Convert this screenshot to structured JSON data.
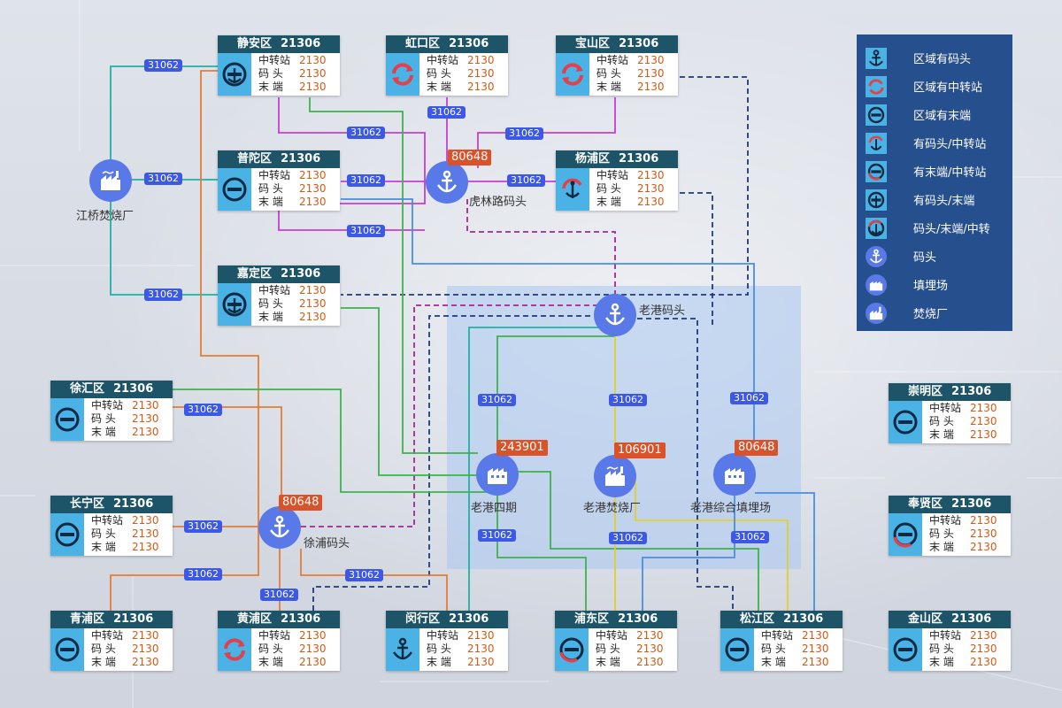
{
  "colors": {
    "card_header": "#1d5468",
    "icon_bg": "#4bb2e5",
    "node": "#5979e8",
    "pill": "#3b58e6",
    "badge": "#d9522a",
    "legend_bg": "#264f8e",
    "value": "#d35a14"
  },
  "field_labels": {
    "transfer": "中转站",
    "dock": "码 头",
    "terminal": "末 端"
  },
  "districts": [
    {
      "name": "静安区",
      "code": "21306",
      "icon": "dock-terminal-icon",
      "transfer": "2130",
      "dock": "2130",
      "terminal": "2130"
    },
    {
      "name": "虹口区",
      "code": "21306",
      "icon": "transfer-icon",
      "transfer": "2130",
      "dock": "2130",
      "terminal": "2130"
    },
    {
      "name": "宝山区",
      "code": "21306",
      "icon": "transfer-icon",
      "transfer": "2130",
      "dock": "2130",
      "terminal": "2130"
    },
    {
      "name": "普陀区",
      "code": "21306",
      "icon": "terminal-icon",
      "transfer": "2130",
      "dock": "2130",
      "terminal": "2130"
    },
    {
      "name": "杨浦区",
      "code": "21306",
      "icon": "dock-transfer-icon",
      "transfer": "2130",
      "dock": "2130",
      "terminal": "2130"
    },
    {
      "name": "嘉定区",
      "code": "21306",
      "icon": "dock-terminal-icon",
      "transfer": "2130",
      "dock": "2130",
      "terminal": "2130"
    },
    {
      "name": "徐汇区",
      "code": "21306",
      "icon": "terminal-icon",
      "transfer": "2130",
      "dock": "2130",
      "terminal": "2130"
    },
    {
      "name": "长宁区",
      "code": "21306",
      "icon": "terminal-icon",
      "transfer": "2130",
      "dock": "2130",
      "terminal": "2130"
    },
    {
      "name": "青浦区",
      "code": "21306",
      "icon": "terminal-icon",
      "transfer": "2130",
      "dock": "2130",
      "terminal": "2130"
    },
    {
      "name": "黄浦区",
      "code": "21306",
      "icon": "transfer-icon",
      "transfer": "2130",
      "dock": "2130",
      "terminal": "2130"
    },
    {
      "name": "闵行区",
      "code": "21306",
      "icon": "dock-icon",
      "transfer": "2130",
      "dock": "2130",
      "terminal": "2130"
    },
    {
      "name": "浦东区",
      "code": "21306",
      "icon": "terminal-transfer-icon",
      "transfer": "2130",
      "dock": "2130",
      "terminal": "2130"
    },
    {
      "name": "松江区",
      "code": "21306",
      "icon": "terminal-icon",
      "transfer": "2130",
      "dock": "2130",
      "terminal": "2130"
    },
    {
      "name": "崇明区",
      "code": "21306",
      "icon": "terminal-icon",
      "transfer": "2130",
      "dock": "2130",
      "terminal": "2130"
    },
    {
      "name": "奉贤区",
      "code": "21306",
      "icon": "terminal-transfer-icon",
      "transfer": "2130",
      "dock": "2130",
      "terminal": "2130"
    },
    {
      "name": "金山区",
      "code": "21306",
      "icon": "terminal-icon",
      "transfer": "2130",
      "dock": "2130",
      "terminal": "2130"
    }
  ],
  "facilities": [
    {
      "name": "江桥焚烧厂",
      "icon": "incinerator-icon",
      "badge": ""
    },
    {
      "name": "虎林路码头",
      "icon": "anchor-icon",
      "badge": "80648"
    },
    {
      "name": "老港码头",
      "icon": "anchor-icon",
      "badge": ""
    },
    {
      "name": "徐浦码头",
      "icon": "anchor-icon",
      "badge": "80648"
    },
    {
      "name": "老港四期",
      "icon": "landfill-icon",
      "badge": "243901"
    },
    {
      "name": "老港焚烧厂",
      "icon": "incinerator-icon",
      "badge": "106901"
    },
    {
      "name": "老港综合填埋场",
      "icon": "landfill-icon",
      "badge": "80648"
    }
  ],
  "flow_label": "31062",
  "legend": [
    {
      "icon": "dock-icon",
      "label": "区域有码头"
    },
    {
      "icon": "transfer-icon",
      "label": "区域有中转站"
    },
    {
      "icon": "terminal-icon",
      "label": "区域有末端"
    },
    {
      "icon": "dock-transfer-icon",
      "label": "有码头/中转站"
    },
    {
      "icon": "terminal-transfer-icon",
      "label": "有末端/中转站"
    },
    {
      "icon": "dock-terminal-icon",
      "label": "有码头/末端"
    },
    {
      "icon": "all-three-icon",
      "label": "码头/末端/中转"
    },
    {
      "icon": "anchor-icon",
      "label": "码头"
    },
    {
      "icon": "landfill-icon",
      "label": "填埋场"
    },
    {
      "icon": "incinerator-icon",
      "label": "焚烧厂"
    }
  ]
}
